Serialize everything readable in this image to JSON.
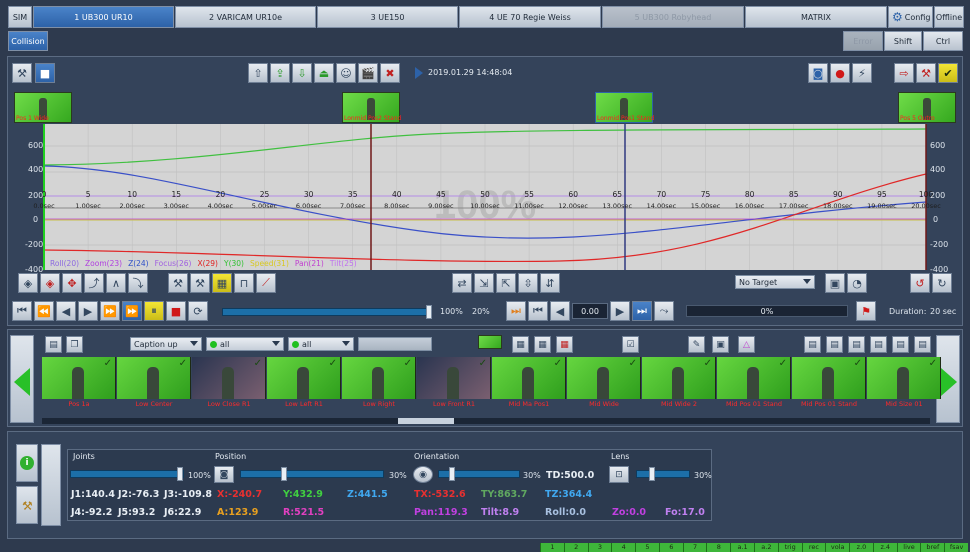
{
  "tabs": {
    "sim": "SIM",
    "cams": [
      {
        "label": "1 UB300 UR10",
        "active": true
      },
      {
        "label": "2 VARICAM UR10e",
        "active": false
      },
      {
        "label": "3 UE150",
        "active": false
      },
      {
        "label": "4 UE 70 Regie Weiss",
        "active": false
      },
      {
        "label": "5 UB300 Robyhead",
        "dim": true
      },
      {
        "label": "MATRIX",
        "active": false
      }
    ],
    "config": "Config",
    "offline": "Offline"
  },
  "second_row": {
    "collision": "Collision",
    "error": "Error",
    "shift": "Shift",
    "ctrl": "Ctrl"
  },
  "timeline": {
    "timestamp": "2019.01.29 14:48:04",
    "zoom_text": "100%",
    "keyframe_labels": [
      "Pos 1 Wide",
      "Lonmid Pos2 Stand",
      "Lonmid Pos1 Stand",
      "Pos 5 Outro"
    ],
    "y_left": [
      "600",
      "400",
      "200",
      "0",
      "-200",
      "-400"
    ],
    "y_right": [
      "600",
      "400",
      "200",
      "0",
      "-200",
      "-400"
    ],
    "x_numbers": [
      "0",
      "5",
      "10",
      "15",
      "20",
      "25",
      "30",
      "35",
      "40",
      "45",
      "50",
      "55",
      "60",
      "65",
      "70",
      "75",
      "80",
      "85",
      "90",
      "95",
      "100"
    ],
    "x_secs": [
      "0.0sec",
      "1.00sec",
      "2.00sec",
      "3.00sec",
      "4.00sec",
      "5.00sec",
      "6.00sec",
      "7.00sec",
      "8.00sec",
      "9.00sec",
      "10.00sec",
      "11.00sec",
      "12.00sec",
      "13.00sec",
      "14.00sec",
      "15.00sec",
      "16.00sec",
      "17.00sec",
      "18.00sec",
      "19.00sec",
      "20.00sec"
    ],
    "legend": [
      {
        "text": "Roll(20)",
        "color": "#a17cf0"
      },
      {
        "text": "Zoom(23)",
        "color": "#b040e0"
      },
      {
        "text": "Z(24)",
        "color": "#3050c8"
      },
      {
        "text": "Focus(26)",
        "color": "#a060e0"
      },
      {
        "text": "X(29)",
        "color": "#e02020"
      },
      {
        "text": "Y(30)",
        "color": "#30c030"
      },
      {
        "text": "Speed(31)",
        "color": "#e0d020"
      },
      {
        "text": "Pan(21)",
        "color": "#c040d0"
      },
      {
        "text": "Tilt(25)",
        "color": "#c070f0"
      }
    ],
    "target_select": "No Target"
  },
  "playback": {
    "speed_percent": "100%",
    "speed_percent2": "20%",
    "time_value": "0.00",
    "progress_percent": "0%",
    "duration_label": "Duration:",
    "duration_value": "20 sec"
  },
  "library": {
    "filter1": "Caption up",
    "filter2": "all",
    "filter3": "all",
    "items": [
      {
        "label": "Pos 1a",
        "dark": false
      },
      {
        "label": "Low Center",
        "dark": false
      },
      {
        "label": "Low Close R1",
        "dark": true
      },
      {
        "label": "Low Left R1",
        "dark": false
      },
      {
        "label": "Low Right",
        "dark": false
      },
      {
        "label": "Low Front R1",
        "dark": true
      },
      {
        "label": "Mid Ma Pos1",
        "dark": false
      },
      {
        "label": "Mid Wide",
        "dark": false
      },
      {
        "label": "Mid Wide 2",
        "dark": false
      },
      {
        "label": "Mid Pos 01 Stand",
        "dark": false
      },
      {
        "label": "Mid Pos 01 Stand",
        "dark": false
      },
      {
        "label": "Mid Size 01",
        "dark": false
      }
    ]
  },
  "bottom": {
    "joints_title": "Joints",
    "joints_percent": "100%",
    "position_title": "Position",
    "position_percent": "30%",
    "orientation_title": "Orientation",
    "orientation_percent": "30%",
    "td": "TD:500.0",
    "lens_title": "Lens",
    "lens_percent": "30%",
    "j1": "J1:140.4",
    "j2": "J2:-76.3",
    "j3": "J3:-109.8",
    "j4": "J4:-92.2",
    "j5": "J5:93.2",
    "j6": "J6:22.9",
    "x": "X:-240.7",
    "y": "Y:432.9",
    "z": "Z:441.5",
    "a": "A:123.9",
    "r": "R:521.5",
    "tx": "TX:-532.6",
    "ty": "TY:863.7",
    "tz": "TZ:364.4",
    "pan": "Pan:119.3",
    "tilt": "Tilt:8.9",
    "roll": "Roll:0.0",
    "zo": "Zo:0.0",
    "fo": "Fo:17.0"
  },
  "status_bar": [
    "1",
    "2",
    "3",
    "4",
    "5",
    "6",
    "7",
    "8",
    "a.1",
    "a.2",
    "trig",
    "rec",
    "vola",
    "z.0",
    "z.4",
    "live",
    "bref",
    "fsav"
  ],
  "colors": {
    "tab_active": "#2d62a8",
    "background": "#2e3a4e",
    "status_green": "#3eb63a"
  }
}
